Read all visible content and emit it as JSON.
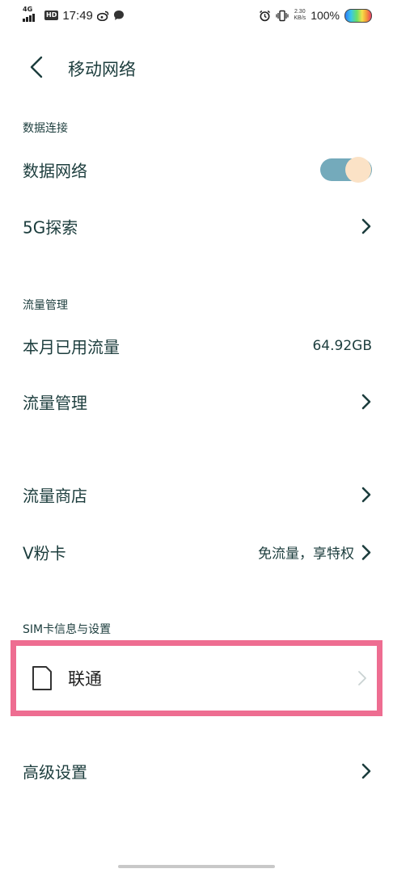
{
  "status_bar": {
    "network": "4G",
    "hd": "HD",
    "time": "17:49",
    "speed_value": "2.30",
    "speed_unit": "KB/s",
    "battery": "100%"
  },
  "header": {
    "title": "移动网络"
  },
  "data_connection": {
    "section_label": "数据连接",
    "data_network": {
      "label": "数据网络",
      "enabled": true
    },
    "explore_5g": {
      "label": "5G探索"
    }
  },
  "traffic": {
    "section_label": "流量管理",
    "monthly_used": {
      "label": "本月已用流量",
      "value": "64.92GB"
    },
    "management": {
      "label": "流量管理"
    },
    "store": {
      "label": "流量商店"
    },
    "vfan_card": {
      "label": "V粉卡",
      "value": "免流量，享特权"
    }
  },
  "sim": {
    "section_label": "SIM卡信息与设置",
    "card": {
      "name": "联通"
    }
  },
  "advanced": {
    "label": "高级设置"
  },
  "colors": {
    "text": "#1c3d3d",
    "toggle_track": "#74aabb",
    "toggle_knob": "#fbe2c6",
    "highlight_border": "#ee6d91"
  }
}
